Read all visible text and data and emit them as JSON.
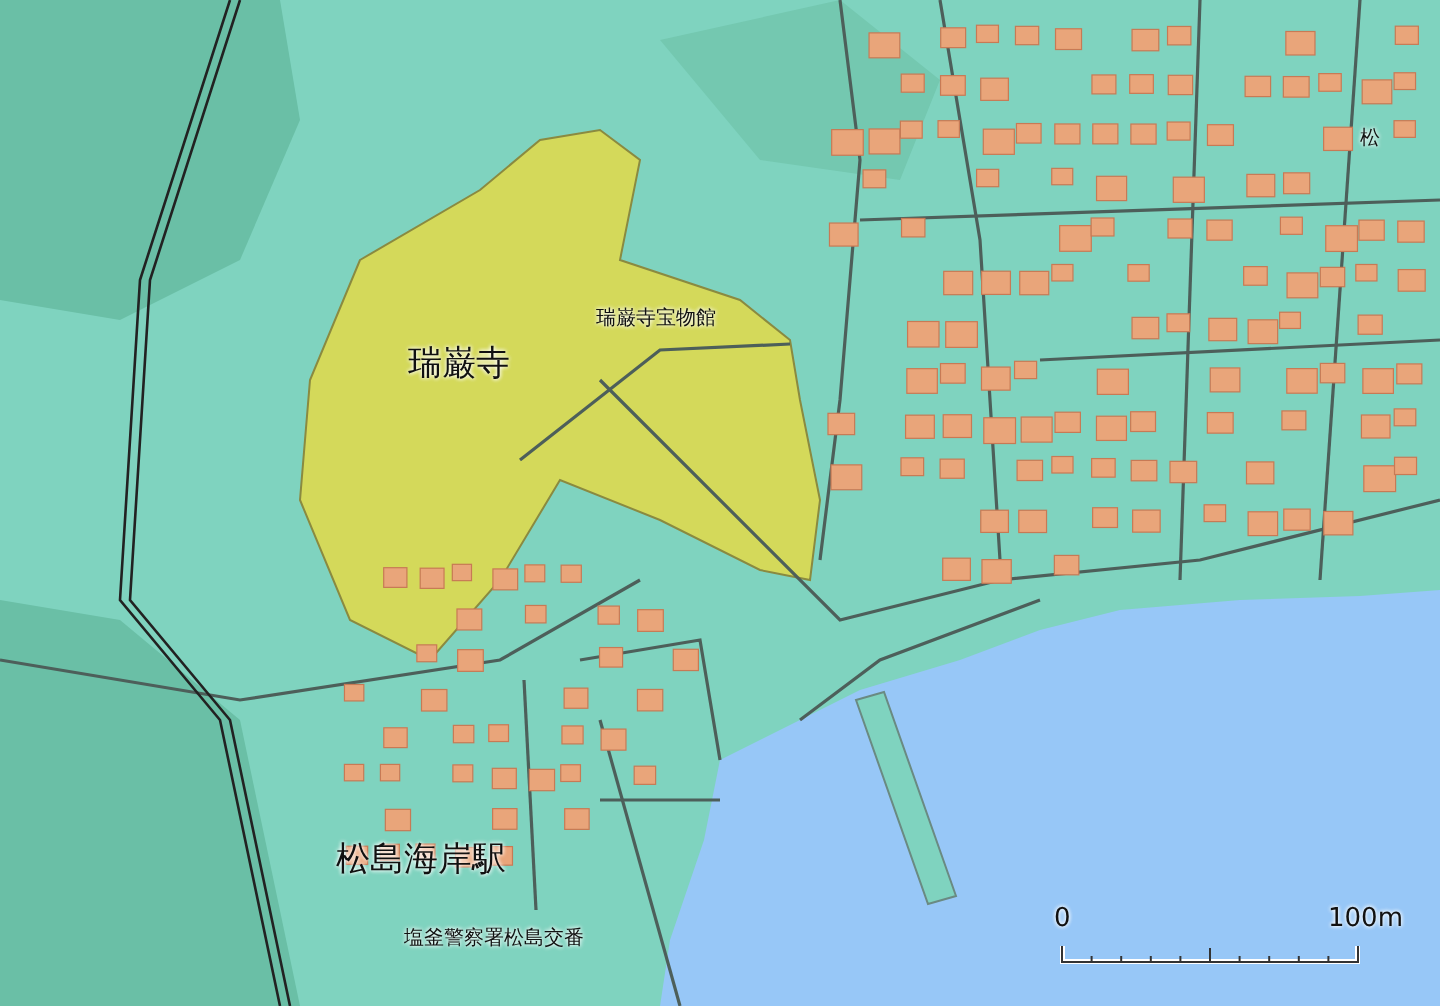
{
  "map": {
    "labels": [
      {
        "text": "瑞巌寺",
        "kind": "landmark"
      },
      {
        "text": "瑞巌寺宝物館",
        "kind": "facility"
      },
      {
        "text": "松島海岸駅",
        "kind": "station"
      },
      {
        "text": "塩釜警察署松島交番",
        "kind": "facility"
      },
      {
        "text": "松",
        "kind": "facility"
      }
    ]
  },
  "scale_bar": {
    "start": "0",
    "end": "100m"
  }
}
